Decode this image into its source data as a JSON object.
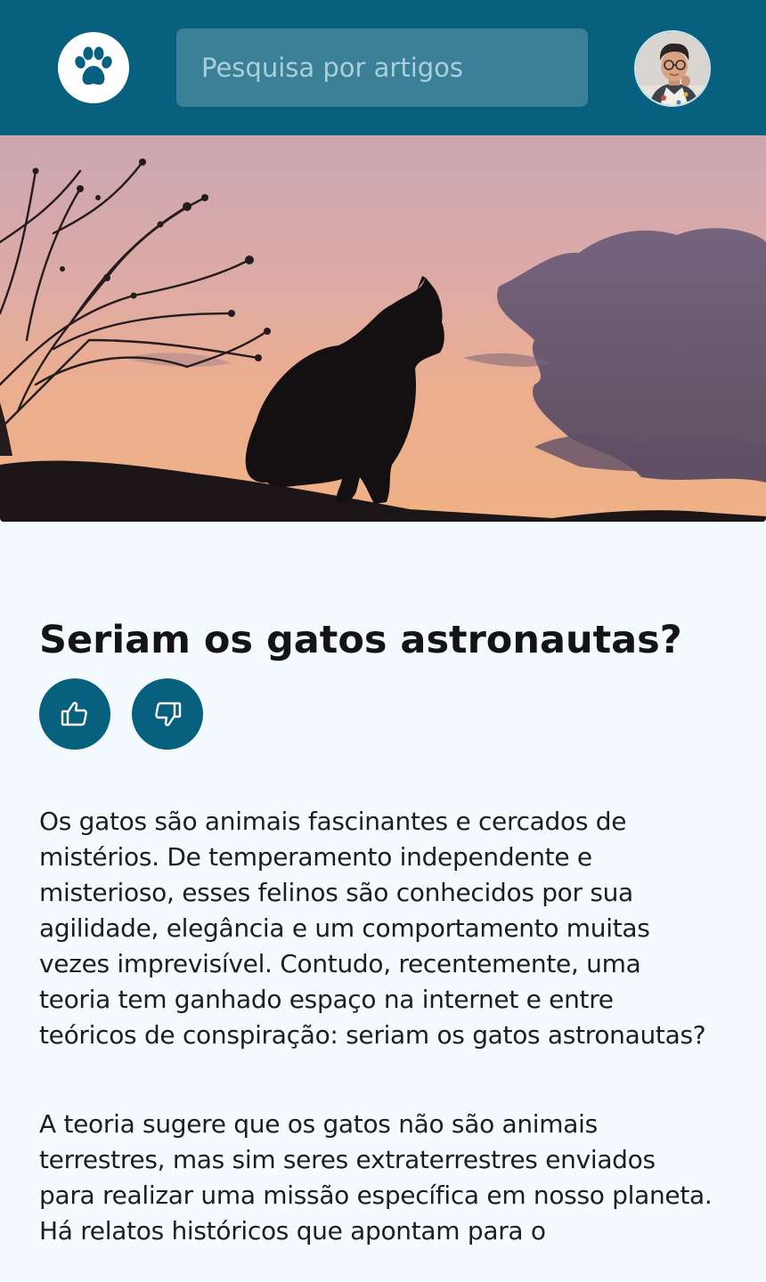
{
  "header": {
    "logo_icon": "paw-icon",
    "search_placeholder": "Pesquisa por artigos",
    "avatar_icon": "user-avatar",
    "brand_color": "#07617e",
    "search_bg": "#3b8097"
  },
  "hero": {
    "image": "cat-silhouette-sunset"
  },
  "article": {
    "title": "Seriam os gatos astronautas?",
    "like_icon": "thumbs-up-icon",
    "dislike_icon": "thumbs-down-icon",
    "paragraphs": [
      "Os gatos são animais fascinantes e cercados de mistérios. De temperamento independente e misterioso, esses felinos são conhecidos por sua agilidade, elegância e um comportamento muitas vezes imprevisível. Contudo, recentemente, uma teoria tem ganhado espaço na internet e entre teóricos de conspiração: seriam os gatos astronautas?",
      "A teoria sugere que os gatos não são animais terrestres, mas sim seres extraterrestres enviados para realizar uma missão específica em nosso planeta. Há relatos históricos que apontam para o"
    ]
  }
}
